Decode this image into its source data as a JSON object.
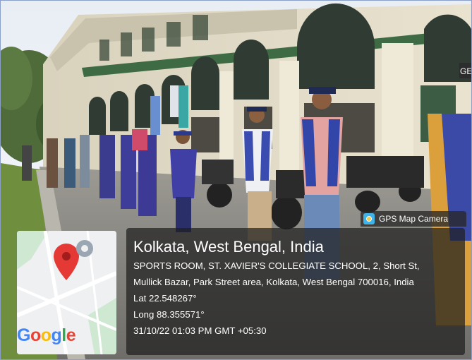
{
  "badge": {
    "label": "GPS Map Camera",
    "icon": "camera-icon"
  },
  "map": {
    "logo": "Google",
    "pin_color": "#e53935"
  },
  "location": {
    "title": "Kolkata, West Bengal, India",
    "address_line1": "SPORTS ROOM, ST. XAVIER'S COLLEGIATE SCHOOL, 2, Short St,",
    "address_line2": "Mullick Bazar, Park Street area, Kolkata, West Bengal 700016, India",
    "lat": "Lat 22.548267°",
    "long": "Long 88.355571°",
    "datetime": "31/10/22 01:03 PM GMT +05:30"
  },
  "building_sign": "GE"
}
